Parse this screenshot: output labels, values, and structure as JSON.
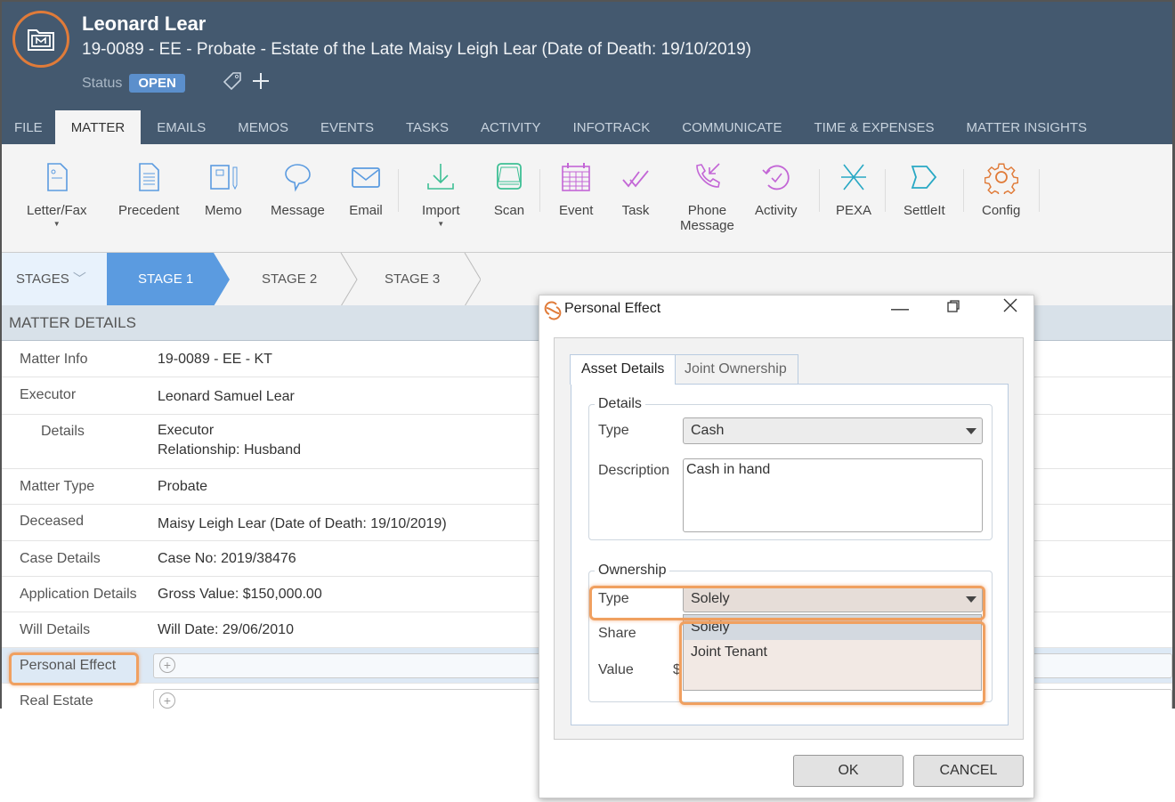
{
  "header": {
    "title": "Leonard Lear",
    "subtitle": "19-0089 - EE - Probate - Estate of the Late Maisy Leigh Lear (Date of Death: 19/10/2019)",
    "status_label": "Status",
    "status_value": "OPEN",
    "icons": [
      "matter-folder-icon",
      "tag-icon",
      "plus-icon"
    ]
  },
  "tabs": [
    "FILE",
    "MATTER",
    "EMAILS",
    "MEMOS",
    "EVENTS",
    "TASKS",
    "ACTIVITY",
    "INFOTRACK",
    "COMMUNICATE",
    "TIME & EXPENSES",
    "MATTER INSIGHTS"
  ],
  "active_tab": "MATTER",
  "ribbon": [
    {
      "label": "Letter/Fax",
      "icon": "letter-icon",
      "dropdown": true
    },
    {
      "label": "Precedent",
      "icon": "document-icon"
    },
    {
      "label": "Memo",
      "icon": "memo-icon"
    },
    {
      "label": "Message",
      "icon": "message-icon"
    },
    {
      "label": "Email",
      "icon": "envelope-icon"
    },
    {
      "label": "Import",
      "icon": "download-icon",
      "dropdown": true
    },
    {
      "label": "Scan",
      "icon": "scanner-icon"
    },
    {
      "label": "Event",
      "icon": "calendar-icon"
    },
    {
      "label": "Task",
      "icon": "task-check-icon"
    },
    {
      "label": "Phone",
      "label2": "Message",
      "icon": "phone-icon"
    },
    {
      "label": "Activity",
      "icon": "activity-icon"
    },
    {
      "label": "PEXA",
      "icon": "pexa-icon"
    },
    {
      "label": "SettleIt",
      "icon": "settleit-icon"
    },
    {
      "label": "Config",
      "icon": "gear-icon"
    }
  ],
  "stages": {
    "menu_label": "STAGES",
    "items": [
      "STAGE 1",
      "STAGE 2",
      "STAGE 3"
    ],
    "active": "STAGE 1"
  },
  "matter_details": {
    "heading": "MATTER DETAILS",
    "rows": [
      {
        "label": "Matter Info",
        "value": "19-0089 - EE - KT"
      },
      {
        "label": "Executor",
        "value": "Leonard Samuel Lear"
      },
      {
        "label": "Details",
        "value": "Executor",
        "value2": "Relationship: Husband"
      },
      {
        "label": "Matter Type",
        "value": "Probate"
      },
      {
        "label": "Deceased",
        "value": "Maisy Leigh Lear (Date of Death: 19/10/2019)"
      },
      {
        "label": "Case Details",
        "value": "Case No: 2019/38476"
      },
      {
        "label": "Application Details",
        "value": "Gross Value: $150,000.00"
      },
      {
        "label": "Will Details",
        "value": "Will Date: 29/06/2010"
      },
      {
        "label": "Personal Effect",
        "value": ""
      },
      {
        "label": "Real Estate",
        "value": ""
      }
    ]
  },
  "dialog": {
    "title": "Personal Effect",
    "tabs": [
      "Asset Details",
      "Joint Ownership"
    ],
    "active_tab": "Asset Details",
    "details": {
      "legend": "Details",
      "type_label": "Type",
      "type_value": "Cash",
      "description_label": "Description",
      "description_value": "Cash in hand"
    },
    "ownership": {
      "legend": "Ownership",
      "type_label": "Type",
      "type_value": "Solely",
      "share_label": "Share",
      "value_label": "Value",
      "value_prefix": "$",
      "options": [
        "Solely",
        "Joint Tenant"
      ],
      "highlighted_option": "Solely"
    },
    "ok_label": "OK",
    "cancel_label": "CANCEL"
  },
  "colors": {
    "header_bg": "#44596f",
    "accent_blue": "#5b9be0",
    "highlight_orange": "#f0a060",
    "open_badge": "#5b8fcc"
  }
}
